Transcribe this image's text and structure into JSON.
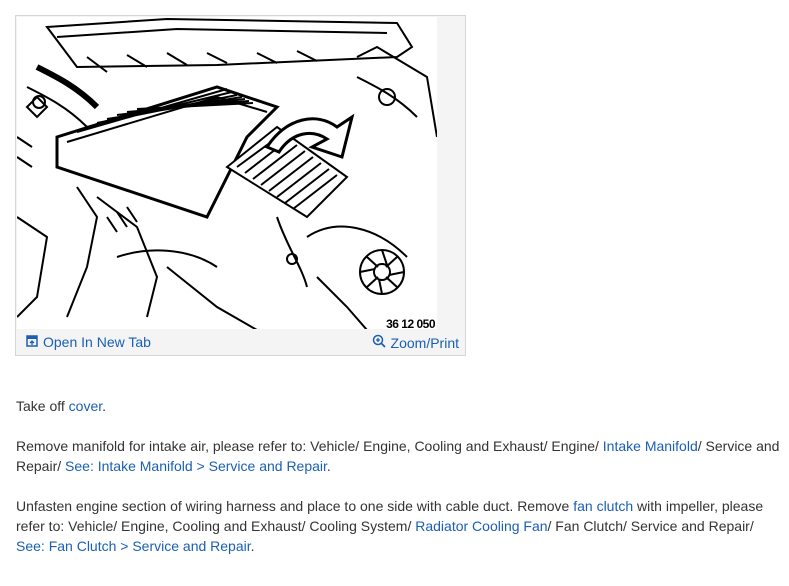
{
  "figure": {
    "number": "36 12 050",
    "open_tab_label": "Open In New Tab",
    "zoom_label": "Zoom/Print",
    "open_tab_icon": "open-new-tab-icon",
    "zoom_icon": "zoom-in-icon"
  },
  "steps": {
    "p1": {
      "before": "Take off ",
      "link": "cover",
      "after": "."
    },
    "p2": {
      "before": "Remove manifold for intake air, please refer to: Vehicle/ Engine, Cooling and Exhaust/ Engine/ ",
      "link1": "Intake Manifold",
      "middle": "/ Service and Repair/ ",
      "link2": "See: Intake Manifold > Service and Repair",
      "after": "."
    },
    "p3": {
      "before": "Unfasten engine section of wiring harness and place to one side with cable duct. Remove ",
      "link1": "fan clutch",
      "middle1": " with impeller, please refer to: Vehicle/ Engine, Cooling and Exhaust/ Cooling System/ ",
      "link2": "Radiator Cooling Fan",
      "middle2": "/ Fan Clutch/ Service and Repair/ ",
      "link3": "See: Fan Clutch > Service and Repair",
      "after": "."
    }
  },
  "colors": {
    "link": "#1a5fb4",
    "text": "#333333"
  }
}
